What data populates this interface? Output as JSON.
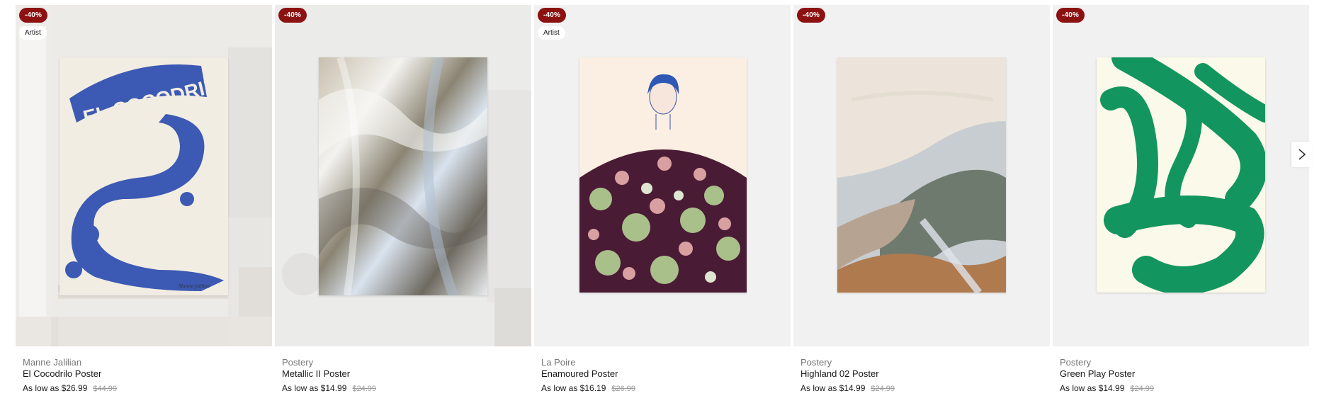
{
  "carousel": {
    "products": [
      {
        "discount": "-40%",
        "tag": "Artist",
        "brand": "Manne Jalilian",
        "title": "El Cocodrilo Poster",
        "price": "As low as $26.99",
        "was_price": "$44.99"
      },
      {
        "discount": "-40%",
        "tag": "",
        "brand": "Postery",
        "title": "Metallic II Poster",
        "price": "As low as $14.99",
        "was_price": "$24.99"
      },
      {
        "discount": "-40%",
        "tag": "Artist",
        "brand": "La Poire",
        "title": "Enamoured Poster",
        "price": "As low as $16.19",
        "was_price": "$26.99"
      },
      {
        "discount": "-40%",
        "tag": "",
        "brand": "Postery",
        "title": "Highland 02 Poster",
        "price": "As low as $14.99",
        "was_price": "$24.99"
      },
      {
        "discount": "-40%",
        "tag": "",
        "brand": "Postery",
        "title": "Green Play Poster",
        "price": "As low as $14.99",
        "was_price": "$24.99"
      }
    ],
    "next_icon": "chevron-right-icon"
  },
  "poster_art": {
    "cocodrilo_text": "EL COCODRILO",
    "cocodrilo_signature": "Manne Jalilian"
  },
  "colors": {
    "discount_badge": "#8c1212",
    "card_background": "#f1f1f1",
    "croc_blue": "#3c59b3",
    "green_play": "#13955f"
  }
}
